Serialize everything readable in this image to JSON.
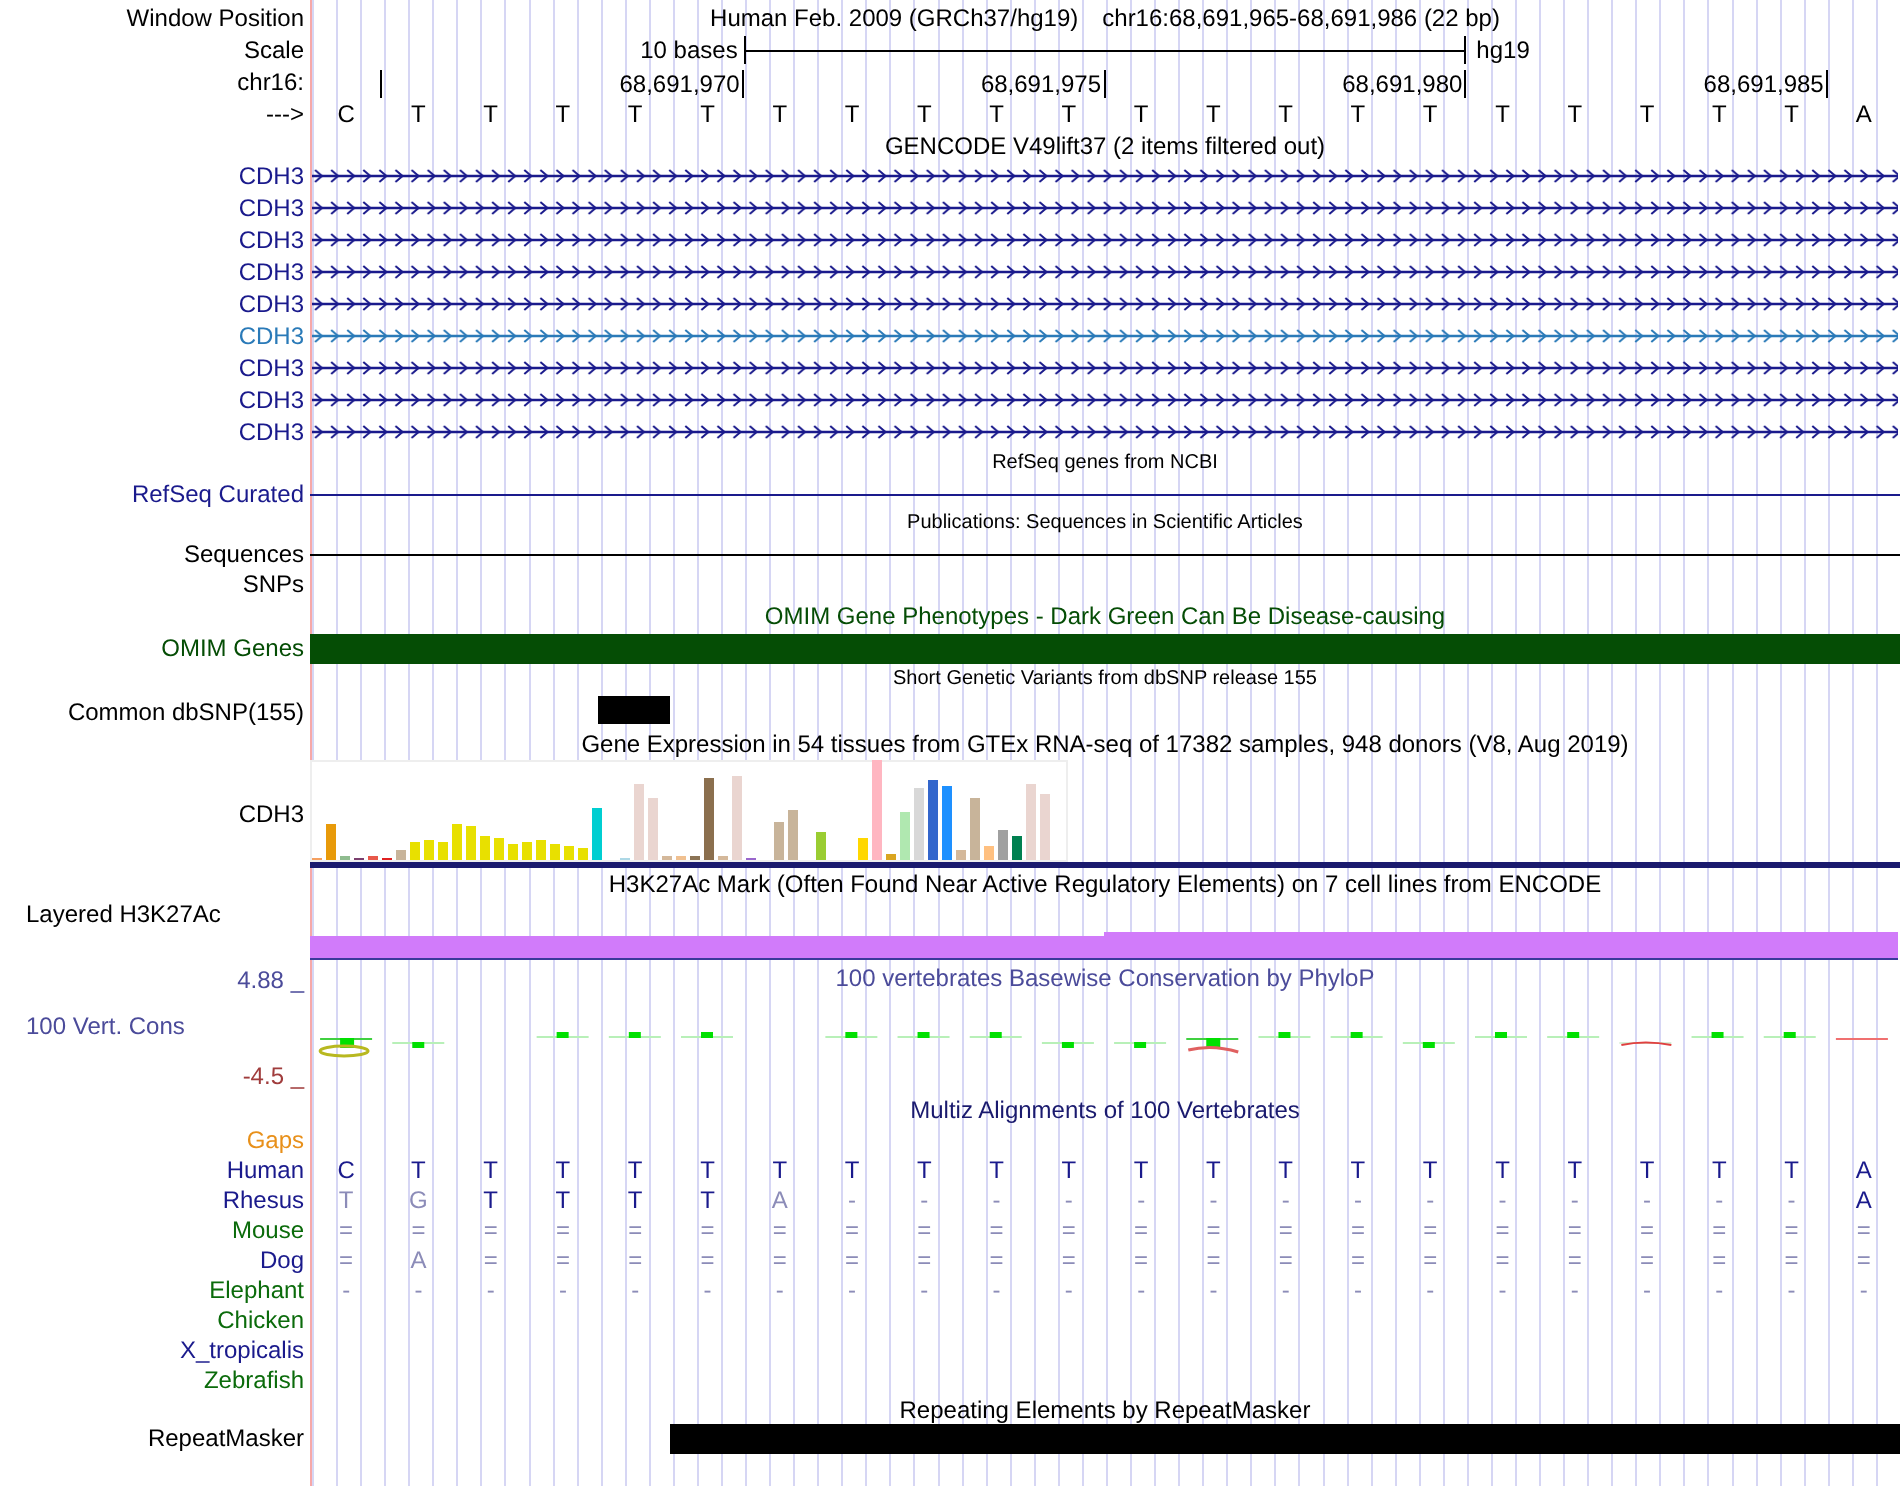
{
  "header": {
    "label": "Window Position",
    "assembly": "Human Feb. 2009 (GRCh37/hg19)",
    "position": "chr16:68,691,965-68,691,986 (22 bp)"
  },
  "scale": {
    "label": "Scale",
    "span": "10 bases",
    "assembly": "hg19"
  },
  "ruler": {
    "label": "chr16:",
    "ticks": [
      "68,691,970",
      "68,691,975",
      "68,691,980",
      "68,691,985"
    ]
  },
  "sequence": {
    "label": "--->",
    "bases": [
      "C",
      "T",
      "T",
      "T",
      "T",
      "T",
      "T",
      "T",
      "T",
      "T",
      "T",
      "T",
      "T",
      "T",
      "T",
      "T",
      "T",
      "T",
      "T",
      "T",
      "T",
      "A"
    ]
  },
  "tracks": [
    {
      "kind": "genes",
      "title": "GENCODE V49lift37 (2 items filtered out)",
      "items": [
        {
          "name": "CDH3",
          "color": "#1a1a8c"
        },
        {
          "name": "CDH3",
          "color": "#1a1a8c"
        },
        {
          "name": "CDH3",
          "color": "#1a1a8c"
        },
        {
          "name": "CDH3",
          "color": "#1a1a8c"
        },
        {
          "name": "CDH3",
          "color": "#1a1a8c"
        },
        {
          "name": "CDH3",
          "color": "#2a7ab8"
        },
        {
          "name": "CDH3",
          "color": "#1a1a8c"
        },
        {
          "name": "CDH3",
          "color": "#1a1a8c"
        },
        {
          "name": "CDH3",
          "color": "#1a1a8c"
        }
      ]
    },
    {
      "kind": "line",
      "title": "RefSeq genes from NCBI",
      "label": "RefSeq Curated",
      "color": "#1a1a8c"
    },
    {
      "kind": "line",
      "title": "Publications: Sequences in Scientific Articles",
      "label": "Sequences",
      "color": "#000000"
    },
    {
      "kind": "empty",
      "label": "SNPs"
    },
    {
      "kind": "bar",
      "title": "OMIM Gene Phenotypes - Dark Green Can Be Disease-causing",
      "label": "OMIM Genes",
      "color": "#054d05"
    },
    {
      "kind": "snp",
      "title": "Short Genetic Variants from dbSNP release 155",
      "label": "Common dbSNP(155)"
    },
    {
      "kind": "expression",
      "title": "Gene Expression in 54 tissues from GTEx RNA-seq of 17382 samples, 948 donors (V8, Aug 2019)",
      "label": "CDH3"
    },
    {
      "kind": "layered",
      "title": "H3K27Ac Mark (Often Found Near Active Regulatory Elements) on 7 cell lines from ENCODE",
      "label": "Layered H3K27Ac"
    },
    {
      "kind": "conservation",
      "title": "100 vertebrates Basewise Conservation by PhyloP",
      "label": "100 Vert. Cons",
      "max": "4.88 _",
      "min": "-4.5 _"
    },
    {
      "kind": "alignment",
      "title": "Multiz Alignments of 100 Vertebrates",
      "gaps_label": "Gaps",
      "species": [
        {
          "name": "Human",
          "color": "#1a1a8c",
          "bases": [
            "C",
            "T",
            "T",
            "T",
            "T",
            "T",
            "T",
            "T",
            "T",
            "T",
            "T",
            "T",
            "T",
            "T",
            "T",
            "T",
            "T",
            "T",
            "T",
            "T",
            "T",
            "A"
          ]
        },
        {
          "name": "Rhesus",
          "color": "#1a1a8c",
          "bases": [
            "T",
            "G",
            "T",
            "T",
            "T",
            "T",
            "A",
            "-",
            "-",
            "-",
            "-",
            "-",
            "-",
            "-",
            "-",
            "-",
            "-",
            "-",
            "-",
            "-",
            "-",
            "A"
          ]
        },
        {
          "name": "Mouse",
          "color": "#0b6b0b",
          "bases": [
            "=",
            "=",
            "=",
            "=",
            "=",
            "=",
            "=",
            "=",
            "=",
            "=",
            "=",
            "=",
            "=",
            "=",
            "=",
            "=",
            "=",
            "=",
            "=",
            "=",
            "=",
            "="
          ]
        },
        {
          "name": "Dog",
          "color": "#1a1a8c",
          "bases": [
            "=",
            "A",
            "=",
            "=",
            "=",
            "=",
            "=",
            "=",
            "=",
            "=",
            "=",
            "=",
            "=",
            "=",
            "=",
            "=",
            "=",
            "=",
            "=",
            "=",
            "=",
            "="
          ]
        },
        {
          "name": "Elephant",
          "color": "#0b6b0b",
          "bases": [
            "-",
            "-",
            "-",
            "-",
            "-",
            "-",
            "-",
            "-",
            "-",
            "-",
            "-",
            "-",
            "-",
            "-",
            "-",
            "-",
            "-",
            "-",
            "-",
            "-",
            "-",
            "-"
          ]
        },
        {
          "name": "Chicken",
          "color": "#0b6b0b"
        },
        {
          "name": "X_tropicalis",
          "color": "#1a1a8c"
        },
        {
          "name": "Zebrafish",
          "color": "#0b6b0b"
        }
      ]
    },
    {
      "kind": "repeat",
      "title": "Repeating Elements by RepeatMasker",
      "label": "RepeatMasker"
    }
  ]
}
